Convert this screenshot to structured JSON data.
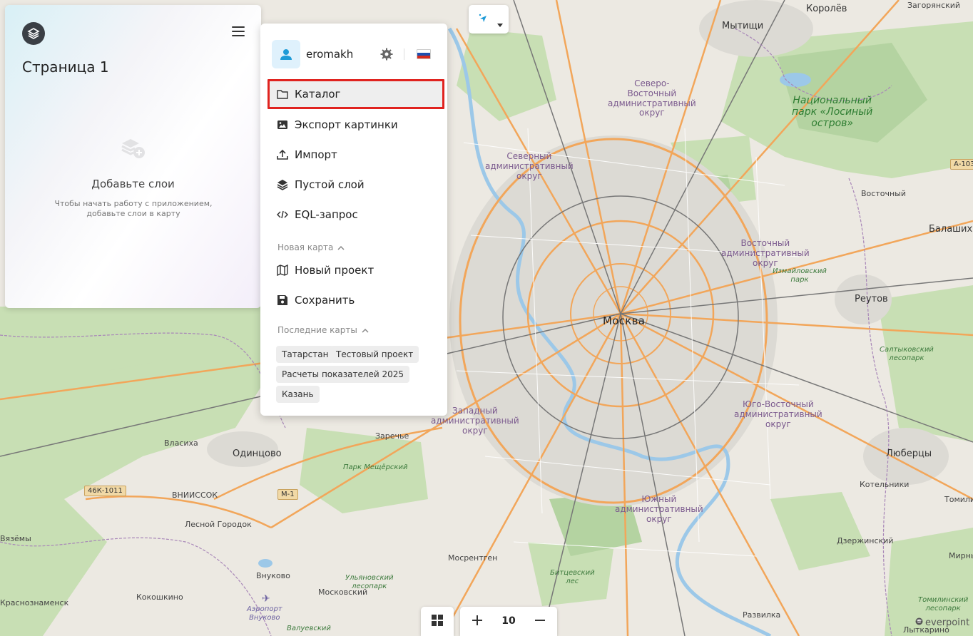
{
  "left_panel": {
    "page_title": "Страница 1",
    "empty_title": "Добавьте слои",
    "empty_subtitle_line1": "Чтобы начать работу с приложением,",
    "empty_subtitle_line2": "добавьте слои в карту"
  },
  "user": {
    "name": "eromakh"
  },
  "menu": {
    "items": [
      {
        "label": "Каталог",
        "icon": "folder-icon",
        "active": true
      },
      {
        "label": "Экспорт картинки",
        "icon": "image-icon"
      },
      {
        "label": "Импорт",
        "icon": "upload-icon"
      },
      {
        "label": "Пустой слой",
        "icon": "layers-icon"
      },
      {
        "label": "EQL-запрос",
        "icon": "code-icon"
      }
    ],
    "new_map_section": "Новая карта",
    "new_map_items": [
      {
        "label": "Новый проект",
        "icon": "map-icon"
      },
      {
        "label": "Сохранить",
        "icon": "save-icon"
      }
    ],
    "recent_section": "Последние карты",
    "recent_maps": [
      "Татарстан",
      "Тестовый проект",
      "Расчеты показателей 2025",
      "Казань"
    ]
  },
  "zoom": {
    "level": "10"
  },
  "branding": {
    "footer_logo": "everpoint"
  },
  "colors": {
    "highlight_border": "#e0231f",
    "avatar_bg": "#dff1fc",
    "accent_blue": "#1e9bd7"
  },
  "map_labels": {
    "moscow": "Москва",
    "korolev": "Королёв",
    "mytishchi": "Мытищи",
    "zagoryansky": "Загорянский",
    "losiny_1": "Национальный",
    "losiny_2": "парк «Лосиный",
    "losiny_3": "остров»",
    "sv_okrug_1": "Северо-",
    "sv_okrug_2": "Восточный",
    "sv_okrug_3": "административный",
    "sv_okrug_4": "округ",
    "s_okrug_1": "Северный",
    "s_okrug_2": "административный",
    "s_okrug_3": "округ",
    "v_okrug_1": "Восточный",
    "v_okrug_2": "административный",
    "v_okrug_3": "округ",
    "uv_okrug_1": "Юго-Восточный",
    "uv_okrug_2": "административный",
    "uv_okrug_3": "округ",
    "z_okrug_1": "Западный",
    "z_okrug_2": "административный",
    "z_okrug_3": "округ",
    "u_okrug_1": "Южный",
    "u_okrug_2": "административный",
    "u_okrug_3": "округ",
    "vostochny": "Восточный",
    "balashikha": "Балаших",
    "reutov": "Реутов",
    "izmaylovsky_1": "Измайловский",
    "izmaylovsky_2": "парк",
    "saltykovsky_1": "Салтыковский",
    "saltykovsky_2": "лесопарк",
    "lyubertsy": "Люберцы",
    "kotelniki": "Котельники",
    "tomilino": "Томили",
    "dzerzhinsky": "Дзержинский",
    "mirny": "Мирны",
    "tomilinsky_1": "Томилинский",
    "tomilinsky_2": "лесопарк",
    "razvilka": "Развилка",
    "lytkarino": "Лыткарино",
    "odintsovo": "Одинцово",
    "zarechye": "Заречье",
    "vlasikha": "Власиха",
    "vniissok": "ВНИИССОК",
    "lesnoy": "Лесной Городок",
    "vyazyomy": "Вязёмы",
    "vnukovo": "Внуково",
    "kokoshkino": "Кокошкино",
    "krasnoznamensk": "Краснознаменск",
    "moskovsky": "Московский",
    "mosrentgen": "Мосрентген",
    "ulyankovsky_1": "Ульяновский",
    "ulyankovsky_2": "лесопарк",
    "bitcevsky_1": "Битцевский",
    "bitcevsky_2": "лес",
    "valuevsky": "Валуевский",
    "airport_1": "Аэропорт",
    "airport_2": "Внуково",
    "park_meshchersky": "Парк Мещёрский",
    "road_46k": "46К-1011",
    "road_m1": "М-1",
    "road_a103": "А-103"
  }
}
